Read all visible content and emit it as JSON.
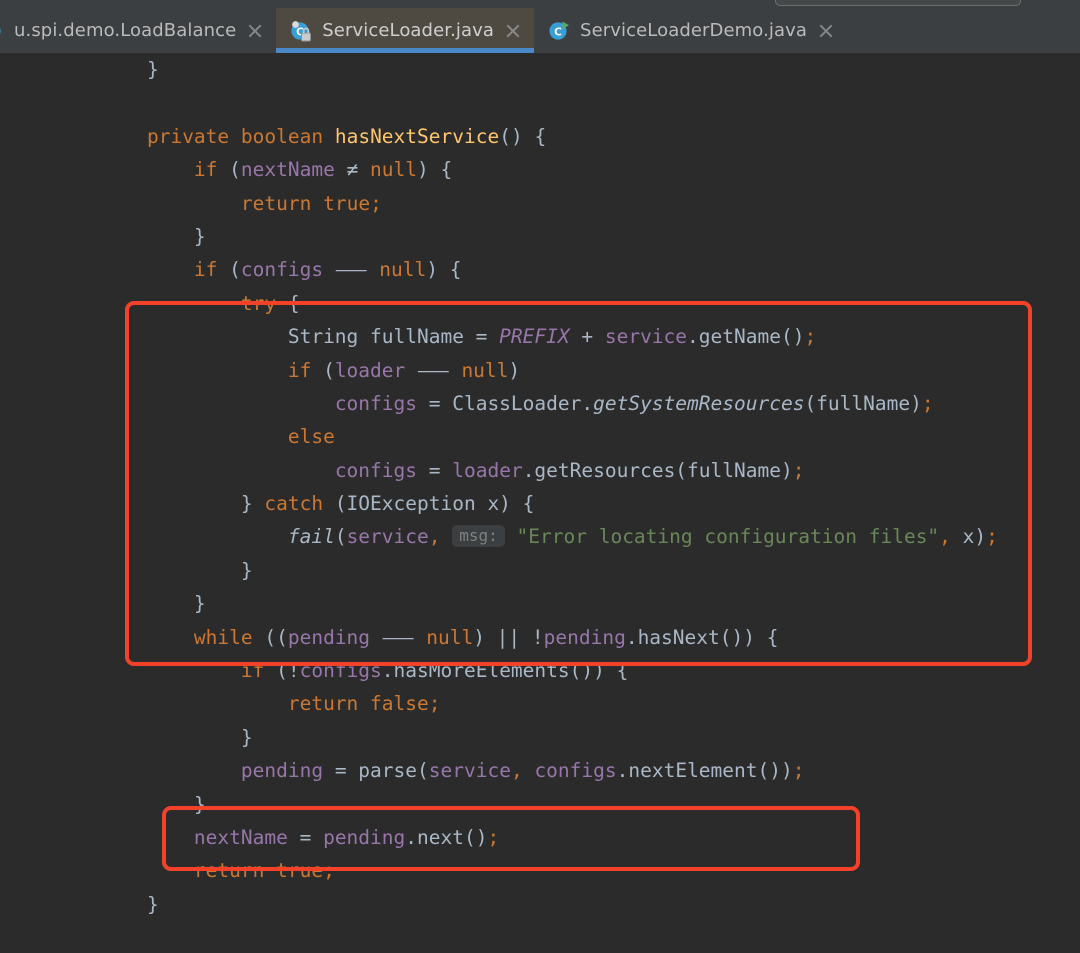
{
  "window": {
    "app": "IntelliJ IDEA",
    "theme_bg": "#2b2b2b",
    "tabbar_bg": "#3c3f41",
    "active_tab_bg": "#4e4a42",
    "active_tab_underline": "#4a88c7",
    "annotation_color": "#f4422a"
  },
  "search_field": {
    "name": "search-everywhere-field",
    "value": "",
    "placeholder": ""
  },
  "tabs": [
    {
      "label": "u.spi.demo.LoadBalance",
      "icon": "java-class-icon",
      "active": false,
      "truncated_left": true,
      "close_icon": "close-icon"
    },
    {
      "label": "ServiceLoader.java",
      "icon": "java-class-readonly-icon",
      "active": true,
      "truncated_left": false,
      "close_icon": "close-icon"
    },
    {
      "label": "ServiceLoaderDemo.java",
      "icon": "java-class-runnable-icon",
      "active": false,
      "truncated_left": false,
      "close_icon": "close-icon"
    }
  ],
  "editor": {
    "language": "java",
    "file": "ServiceLoader.java",
    "lines": [
      {
        "indent": 1,
        "tokens": [
          {
            "t": "txt",
            "v": "}"
          }
        ]
      },
      {
        "indent": 0,
        "tokens": []
      },
      {
        "indent": 1,
        "tokens": [
          {
            "t": "kw",
            "v": "private"
          },
          {
            "t": "txt",
            "v": " "
          },
          {
            "t": "kw",
            "v": "boolean"
          },
          {
            "t": "txt",
            "v": " "
          },
          {
            "t": "mdecl",
            "v": "hasNextService"
          },
          {
            "t": "txt",
            "v": "() {"
          }
        ]
      },
      {
        "indent": 2,
        "tokens": [
          {
            "t": "kw",
            "v": "if"
          },
          {
            "t": "txt",
            "v": " ("
          },
          {
            "t": "fld",
            "v": "nextName"
          },
          {
            "t": "txt",
            "v": " ≠ "
          },
          {
            "t": "kw",
            "v": "null"
          },
          {
            "t": "txt",
            "v": ") {"
          }
        ]
      },
      {
        "indent": 3,
        "tokens": [
          {
            "t": "kw",
            "v": "return"
          },
          {
            "t": "txt",
            "v": " "
          },
          {
            "t": "kw",
            "v": "true"
          },
          {
            "t": "semi",
            "v": ";"
          }
        ]
      },
      {
        "indent": 2,
        "tokens": [
          {
            "t": "txt",
            "v": "}"
          }
        ]
      },
      {
        "indent": 2,
        "tokens": [
          {
            "t": "kw",
            "v": "if"
          },
          {
            "t": "txt",
            "v": " ("
          },
          {
            "t": "fld",
            "v": "configs"
          },
          {
            "t": "txt",
            "v": " ⸺ "
          },
          {
            "t": "kw",
            "v": "null"
          },
          {
            "t": "txt",
            "v": ") {"
          }
        ]
      },
      {
        "indent": 3,
        "tokens": [
          {
            "t": "kw",
            "v": "try"
          },
          {
            "t": "txt",
            "v": " {"
          }
        ]
      },
      {
        "indent": 4,
        "tokens": [
          {
            "t": "txt",
            "v": "String fullName = "
          },
          {
            "t": "sfld",
            "v": "PREFIX"
          },
          {
            "t": "txt",
            "v": " + "
          },
          {
            "t": "fld",
            "v": "service"
          },
          {
            "t": "txt",
            "v": ".getName()"
          },
          {
            "t": "semi",
            "v": ";"
          }
        ]
      },
      {
        "indent": 4,
        "tokens": [
          {
            "t": "kw",
            "v": "if"
          },
          {
            "t": "txt",
            "v": " ("
          },
          {
            "t": "fld",
            "v": "loader"
          },
          {
            "t": "txt",
            "v": " ⸺ "
          },
          {
            "t": "kw",
            "v": "null"
          },
          {
            "t": "txt",
            "v": ")"
          }
        ]
      },
      {
        "indent": 5,
        "tokens": [
          {
            "t": "fld",
            "v": "configs"
          },
          {
            "t": "txt",
            "v": " = ClassLoader."
          },
          {
            "t": "smth",
            "v": "getSystemResources"
          },
          {
            "t": "txt",
            "v": "(fullName)"
          },
          {
            "t": "semi",
            "v": ";"
          }
        ]
      },
      {
        "indent": 4,
        "tokens": [
          {
            "t": "kw",
            "v": "else"
          }
        ]
      },
      {
        "indent": 5,
        "tokens": [
          {
            "t": "fld",
            "v": "configs"
          },
          {
            "t": "txt",
            "v": " = "
          },
          {
            "t": "fld",
            "v": "loader"
          },
          {
            "t": "txt",
            "v": ".getResources(fullName)"
          },
          {
            "t": "semi",
            "v": ";"
          }
        ]
      },
      {
        "indent": 3,
        "tokens": [
          {
            "t": "txt",
            "v": "} "
          },
          {
            "t": "kw",
            "v": "catch"
          },
          {
            "t": "txt",
            "v": " (IOException x) {"
          }
        ]
      },
      {
        "indent": 4,
        "tokens": [
          {
            "t": "smth",
            "v": "fail"
          },
          {
            "t": "txt",
            "v": "("
          },
          {
            "t": "fld",
            "v": "service"
          },
          {
            "t": "semi",
            "v": ","
          },
          {
            "t": "txt",
            "v": " "
          },
          {
            "t": "hint",
            "v": "msg:"
          },
          {
            "t": "str",
            "v": "\"Error locating configuration files\""
          },
          {
            "t": "semi",
            "v": ","
          },
          {
            "t": "txt",
            "v": " x)"
          },
          {
            "t": "semi",
            "v": ";"
          }
        ]
      },
      {
        "indent": 3,
        "tokens": [
          {
            "t": "txt",
            "v": "}"
          }
        ]
      },
      {
        "indent": 2,
        "tokens": [
          {
            "t": "txt",
            "v": "}"
          }
        ]
      },
      {
        "indent": 2,
        "tokens": [
          {
            "t": "kw",
            "v": "while"
          },
          {
            "t": "txt",
            "v": " (("
          },
          {
            "t": "fld",
            "v": "pending"
          },
          {
            "t": "txt",
            "v": " ⸺ "
          },
          {
            "t": "kw",
            "v": "null"
          },
          {
            "t": "txt",
            "v": ") || !"
          },
          {
            "t": "fld",
            "v": "pending"
          },
          {
            "t": "txt",
            "v": ".hasNext()) {"
          }
        ]
      },
      {
        "indent": 3,
        "tokens": [
          {
            "t": "kw",
            "v": "if"
          },
          {
            "t": "txt",
            "v": " (!"
          },
          {
            "t": "fld",
            "v": "configs"
          },
          {
            "t": "txt",
            "v": ".hasMoreElements()) {"
          }
        ]
      },
      {
        "indent": 4,
        "tokens": [
          {
            "t": "kw",
            "v": "return"
          },
          {
            "t": "txt",
            "v": " "
          },
          {
            "t": "kw",
            "v": "false"
          },
          {
            "t": "semi",
            "v": ";"
          }
        ]
      },
      {
        "indent": 3,
        "tokens": [
          {
            "t": "txt",
            "v": "}"
          }
        ]
      },
      {
        "indent": 3,
        "tokens": [
          {
            "t": "fld",
            "v": "pending"
          },
          {
            "t": "txt",
            "v": " = parse("
          },
          {
            "t": "fld",
            "v": "service"
          },
          {
            "t": "semi",
            "v": ","
          },
          {
            "t": "txt",
            "v": " "
          },
          {
            "t": "fld",
            "v": "configs"
          },
          {
            "t": "txt",
            "v": ".nextElement())"
          },
          {
            "t": "semi",
            "v": ";"
          }
        ]
      },
      {
        "indent": 2,
        "tokens": [
          {
            "t": "txt",
            "v": "}"
          }
        ]
      },
      {
        "indent": 2,
        "tokens": [
          {
            "t": "fld",
            "v": "nextName"
          },
          {
            "t": "txt",
            "v": " = "
          },
          {
            "t": "fld",
            "v": "pending"
          },
          {
            "t": "txt",
            "v": ".next()"
          },
          {
            "t": "semi",
            "v": ";"
          }
        ]
      },
      {
        "indent": 2,
        "tokens": [
          {
            "t": "kw",
            "v": "return"
          },
          {
            "t": "txt",
            "v": " "
          },
          {
            "t": "kw",
            "v": "true"
          },
          {
            "t": "semi",
            "v": ";"
          }
        ]
      },
      {
        "indent": 1,
        "tokens": [
          {
            "t": "txt",
            "v": "}"
          }
        ]
      }
    ]
  },
  "annotations": [
    {
      "name": "highlight-box-configs-init",
      "shape": "rounded-rect",
      "color": "#f4422a"
    },
    {
      "name": "highlight-box-parse-call",
      "shape": "rounded-rect",
      "color": "#f4422a"
    }
  ]
}
